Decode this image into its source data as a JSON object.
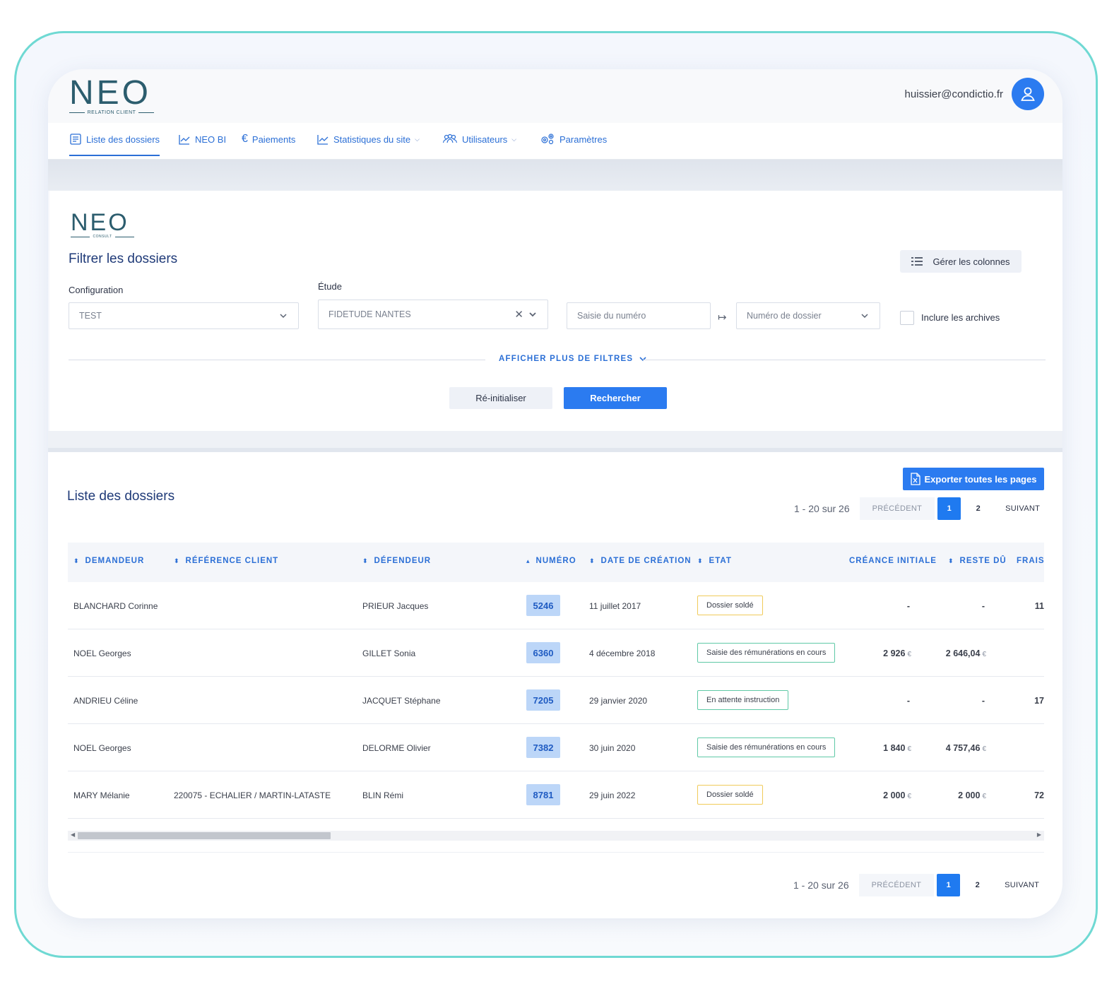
{
  "header": {
    "logo": {
      "word": "NEO",
      "subtitle": "RELATION CLIENT"
    },
    "user_email": "huissier@condictio.fr"
  },
  "nav": {
    "items": [
      {
        "label": "Liste des dossiers",
        "icon": "folder-list-icon",
        "active": true
      },
      {
        "label": "NEO BI",
        "icon": "chart-icon"
      },
      {
        "label": "Paiements",
        "icon": "euro-icon"
      },
      {
        "label": "Statistiques du site",
        "icon": "stats-icon",
        "dropdown": true
      },
      {
        "label": "Utilisateurs",
        "icon": "users-icon",
        "dropdown": true
      },
      {
        "label": "Paramètres",
        "icon": "gears-icon"
      }
    ]
  },
  "filter": {
    "logo": {
      "word": "NEO",
      "subtitle": "CONSULT"
    },
    "title": "Filtrer les dossiers",
    "manage_columns": "Gérer les colonnes",
    "configuration_label": "Configuration",
    "configuration_value": "TEST",
    "etude_label": "Étude",
    "etude_value": "FIDETUDE NANTES",
    "numero_placeholder": "Saisie du numéro",
    "numero_type": "Numéro de dossier",
    "include_archives": "Inclure les archives",
    "more_filters": "AFFICHER PLUS DE FILTRES",
    "reset": "Ré-initialiser",
    "search": "Rechercher"
  },
  "list": {
    "title": "Liste des dossiers",
    "export": "Exporter toutes les pages",
    "pagination": {
      "range": "1 - 20 sur 26",
      "prev": "PRÉCÉDENT",
      "next": "SUIVANT",
      "pages": [
        "1",
        "2"
      ],
      "current": "1"
    },
    "columns": {
      "demandeur": "DEMANDEUR",
      "reference": "RÉFÉRENCE CLIENT",
      "defendeur": "DÉFENDEUR",
      "numero": "NUMÉRO",
      "date": "DATE DE CRÉATION",
      "etat": "ETAT",
      "creance": "CRÉANCE INITIALE",
      "reste": "RESTE DÛ",
      "frais": "FRAIS"
    },
    "currency": "€",
    "rows": [
      {
        "demandeur": "BLANCHARD Corinne",
        "reference": "",
        "defendeur": "PRIEUR Jacques",
        "numero": "5246",
        "date": "11 juillet 2017",
        "etat": "Dossier soldé",
        "etat_kind": "warn",
        "creance": "-",
        "reste": "-",
        "frais": "11"
      },
      {
        "demandeur": "NOEL Georges",
        "reference": "",
        "defendeur": "GILLET Sonia",
        "numero": "6360",
        "date": "4 décembre 2018",
        "etat": "Saisie des rémunérations en cours",
        "etat_kind": "ok",
        "creance": "2 926",
        "reste": "2 646,04",
        "frais": ""
      },
      {
        "demandeur": "ANDRIEU Céline",
        "reference": "",
        "defendeur": "JACQUET Stéphane",
        "numero": "7205",
        "date": "29 janvier 2020",
        "etat": "En attente instruction",
        "etat_kind": "ok",
        "creance": "-",
        "reste": "-",
        "frais": "17"
      },
      {
        "demandeur": "NOEL Georges",
        "reference": "",
        "defendeur": "DELORME Olivier",
        "numero": "7382",
        "date": "30 juin 2020",
        "etat": "Saisie des rémunérations en cours",
        "etat_kind": "ok",
        "creance": "1 840",
        "reste": "4 757,46",
        "frais": ""
      },
      {
        "demandeur": "MARY Mélanie",
        "reference": "220075 - ECHALIER / MARTIN-LATASTE",
        "defendeur": "BLIN Rémi",
        "numero": "8781",
        "date": "29 juin 2022",
        "etat": "Dossier soldé",
        "etat_kind": "warn",
        "creance": "2 000",
        "reste": "2 000",
        "frais": "72"
      }
    ]
  },
  "colors": {
    "accent": "#2b7bf0",
    "frame": "#6fd9d3",
    "title": "#1f3a78",
    "warn": "#f0cb5a",
    "ok": "#5fc9a6"
  }
}
